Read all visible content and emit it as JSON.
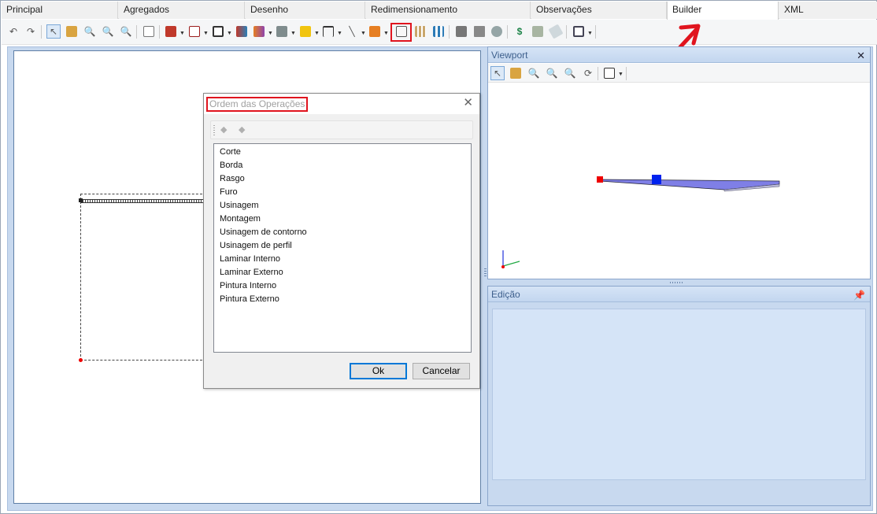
{
  "tabs": [
    {
      "label": "Principal"
    },
    {
      "label": "Agregados"
    },
    {
      "label": "Desenho"
    },
    {
      "label": "Redimensionamento"
    },
    {
      "label": "Observações"
    },
    {
      "label": "Builder",
      "active": true
    },
    {
      "label": "XML"
    }
  ],
  "toolbar": {
    "icons": [
      "undo-icon",
      "redo-icon",
      "select-icon",
      "pan-icon",
      "zoom-in-icon",
      "zoom-window-icon",
      "zoom-extents-icon",
      "new-icon",
      "tool-icon",
      "panel-icon",
      "frame-icon",
      "color-icon",
      "chart-icon",
      "curve-icon",
      "fill-icon",
      "dimension-icon",
      "line-icon",
      "copy-icon",
      "operations-order-icon",
      "grid-icon",
      "columns-icon",
      "box-icon",
      "cabinet-icon",
      "money-bag-icon",
      "cost-icon",
      "material-icon",
      "eraser-icon",
      "view-icon"
    ]
  },
  "dialog": {
    "title": "Ordem das Operações",
    "items": [
      "Corte",
      "Borda",
      "Rasgo",
      "Furo",
      "Usinagem",
      "Montagem",
      "Usinagem de contorno",
      "Usinagem de perfil",
      "Laminar Interno",
      "Laminar Externo",
      "Pintura Interno",
      "Pintura Externo"
    ],
    "ok_label": "Ok",
    "cancel_label": "Cancelar"
  },
  "viewport": {
    "title": "Viewport"
  },
  "edicao": {
    "title": "Edição"
  },
  "colors": {
    "annotation": "#e0141e",
    "panel_title": "#3d5f8c",
    "accent": "#0078d7"
  }
}
